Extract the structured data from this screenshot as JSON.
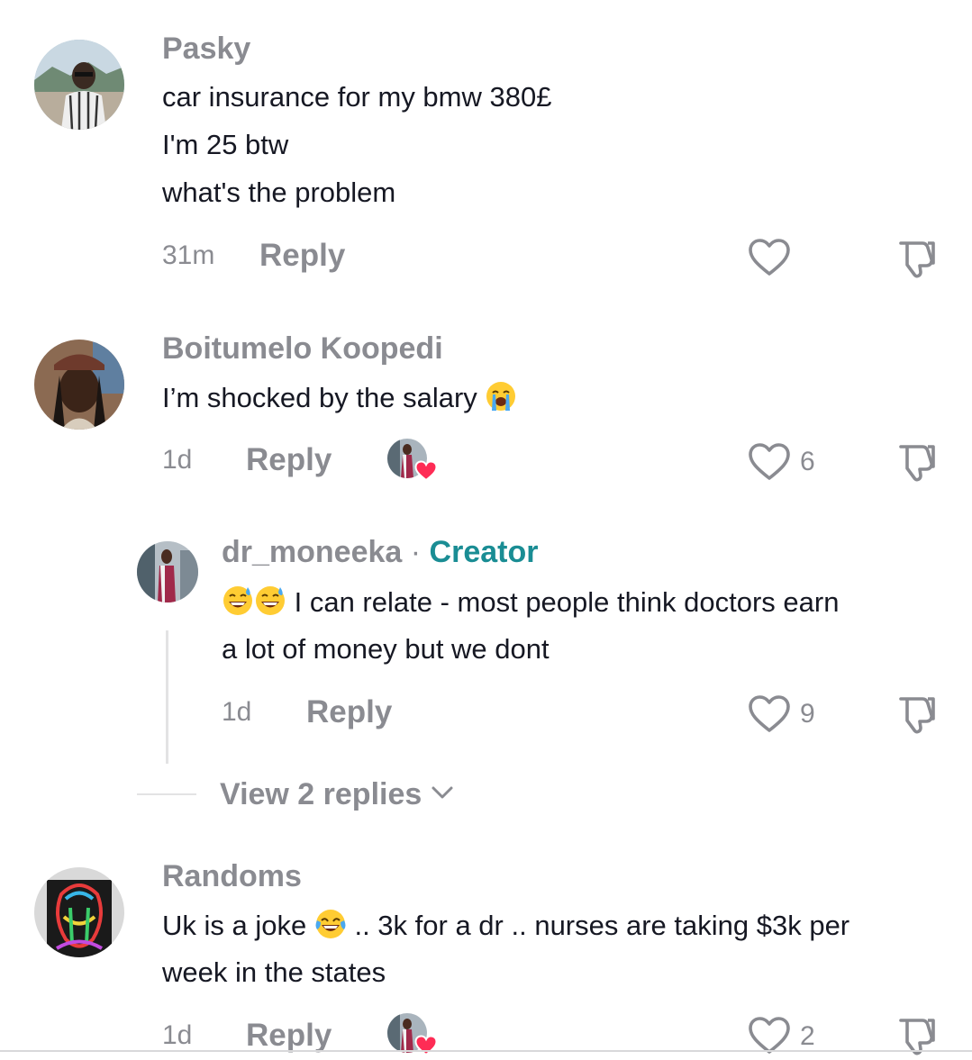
{
  "comments": [
    {
      "username": "Pasky",
      "lines": [
        "car insurance for my bmw 380£",
        "I'm 25 btw",
        "what's the problem"
      ],
      "time": "31m",
      "reply_label": "Reply",
      "likes": ""
    },
    {
      "username": "Boitumelo Koopedi",
      "text": "I’m shocked by the salary",
      "emoji": "loudly-crying-face",
      "time": "1d",
      "reply_label": "Reply",
      "likes": "6"
    },
    {
      "username": "Randoms",
      "line1_start": "Uk is a joke",
      "emoji": "face-with-tears-of-joy",
      "line1_end": " .. 3k for a dr .. nurses are taking $3k per",
      "line2": "week in the states",
      "time": "1d",
      "reply_label": "Reply",
      "likes": "2"
    }
  ],
  "reply": {
    "username": "dr_moneeka",
    "separator": " · ",
    "creator_label": "Creator",
    "emojis": [
      "grinning-face-with-sweat",
      "grinning-face-with-sweat"
    ],
    "line1": " I can relate - most people think doctors earn",
    "line2": "a lot of money but we dont",
    "time": "1d",
    "reply_label": "Reply",
    "likes": "9"
  },
  "view_replies_label": "View 2 replies",
  "colors": {
    "secondary_text": "#8a8b91",
    "creator": "#1a8d94",
    "heart_badge": "#fe2c55"
  }
}
